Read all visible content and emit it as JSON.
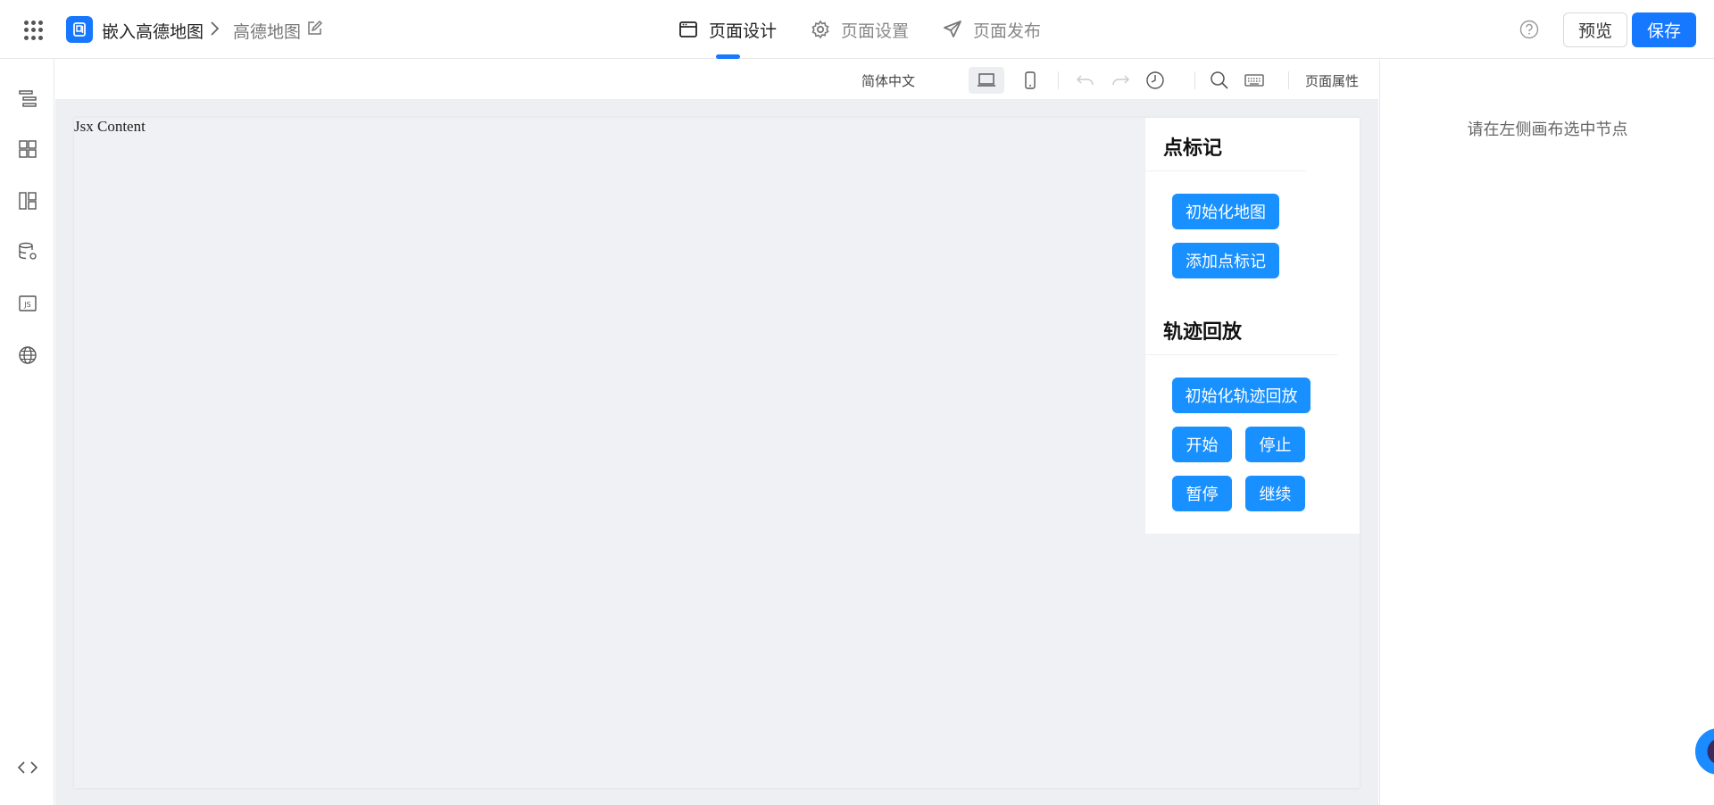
{
  "header": {
    "app_name": "嵌入高德地图",
    "page_name": "高德地图",
    "tabs": [
      {
        "label": "页面设计",
        "active": true
      },
      {
        "label": "页面设置",
        "active": false
      },
      {
        "label": "页面发布",
        "active": false
      }
    ],
    "preview_label": "预览",
    "save_label": "保存"
  },
  "toolbar": {
    "language": "简体中文",
    "page_attr_label": "页面属性"
  },
  "canvas": {
    "jsx_label": "Jsx Content",
    "panel": {
      "section1_title": "点标记",
      "section1_buttons": [
        "初始化地图",
        "添加点标记"
      ],
      "section2_title": "轨迹回放",
      "section2_buttons": [
        "初始化轨迹回放",
        "开始",
        "停止",
        "暂停",
        "继续"
      ]
    }
  },
  "props": {
    "hint": "请在左侧画布选中节点"
  },
  "colors": {
    "accent": "#1677ff",
    "canvas_bg": "#f0f1f4"
  }
}
